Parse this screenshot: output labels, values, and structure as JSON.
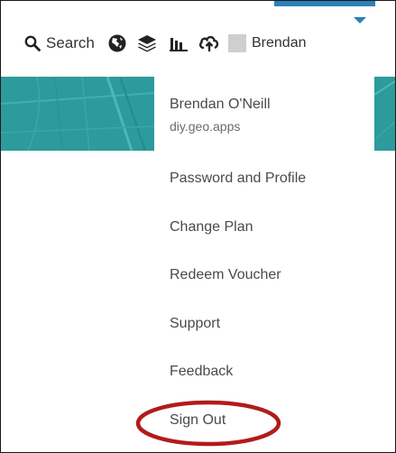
{
  "nav": {
    "search_label": "Search",
    "user_label": "Brendan",
    "icons": [
      "search-icon",
      "globe-icon",
      "layers-icon",
      "bar-chart-icon",
      "cloud-upload-icon",
      "user-avatar"
    ]
  },
  "menu": {
    "user_name": "Brendan O'Neill",
    "org_name": "diy.geo.apps",
    "items": [
      {
        "label": "Password and Profile"
      },
      {
        "label": "Change Plan"
      },
      {
        "label": "Redeem Voucher"
      },
      {
        "label": "Support"
      },
      {
        "label": "Feedback"
      },
      {
        "label": "Sign Out"
      }
    ]
  },
  "colors": {
    "accent": "#2c7fb8",
    "map_teal": "#2d9a9c",
    "highlight_ring": "#b01c1c"
  }
}
